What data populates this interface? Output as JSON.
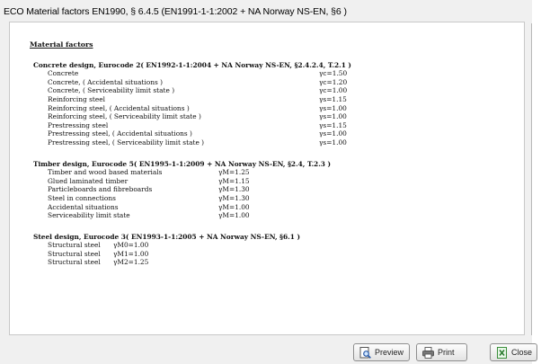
{
  "window": {
    "title": "ECO Material factors  EN1990, § 6.4.5  (EN1991-1-1:2002 + NA Norway NS-EN, §6 )"
  },
  "report": {
    "heading": "Material factors",
    "sections": [
      {
        "title": "Concrete design,  Eurocode 2( EN1992-1-1:2004 +  NA Norway NS-EN, §2.4.2.4, T.2.1 )",
        "rows": [
          {
            "name": "Concrete",
            "value": "γc=1.50"
          },
          {
            "name": "Concrete, ( Accidental situations )",
            "value": "γc=1.20"
          },
          {
            "name": "Concrete, ( Serviceability limit state )",
            "value": "γc=1.00"
          },
          {
            "name": "Reinforcing steel",
            "value": "γs=1.15"
          },
          {
            "name": "Reinforcing steel, ( Accidental situations )",
            "value": "γs=1.00"
          },
          {
            "name": "Reinforcing steel, ( Serviceability limit state )",
            "value": "γs=1.00"
          },
          {
            "name": "Prestressing steel",
            "value": "γs=1.15"
          },
          {
            "name": "Prestressing steel, ( Accidental situations )",
            "value": "γs=1.00"
          },
          {
            "name": "Prestressing steel, ( Serviceability limit state )",
            "value": "γs=1.00"
          }
        ]
      },
      {
        "title": "Timber design, Eurocode 5( EN1995-1-1:2009 +  NA Norway NS-EN, §2.4, T.2.3 )",
        "rows": [
          {
            "name": "Timber and wood based materials",
            "value": "γM=1.25"
          },
          {
            "name": "Glued laminated timber",
            "value": "γM=1.15"
          },
          {
            "name": "Particleboards and fibreboards",
            "value": "γM=1.30"
          },
          {
            "name": "Steel in connections",
            "value": "γM=1.30"
          },
          {
            "name": "Accidental situations",
            "value": "γM=1.00"
          },
          {
            "name": "Serviceability limit state",
            "value": "γM=1.00"
          }
        ]
      },
      {
        "title": "Steel design, Eurocode 3( EN1993-1-1:2005 +  NA Norway NS-EN, §6.1 )",
        "rows": [
          {
            "name": "Structural steel",
            "value": "γM0=1.00"
          },
          {
            "name": "Structural steel",
            "value": "γM1=1.00"
          },
          {
            "name": "Structural steel",
            "value": "γM2=1.25"
          }
        ]
      }
    ]
  },
  "buttons": {
    "preview_label": "Preview",
    "print_label": "Print",
    "close_label": "Close"
  },
  "icons": {
    "preview": "preview-icon",
    "print": "printer-icon",
    "close": "close-icon"
  }
}
